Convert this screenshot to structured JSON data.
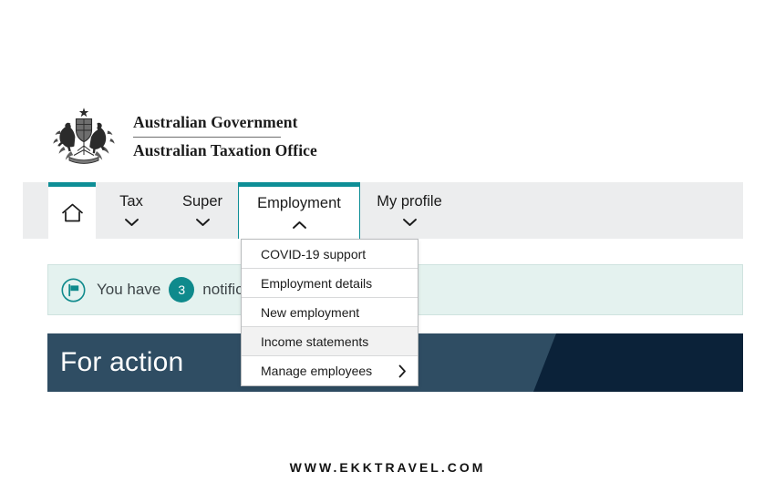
{
  "masthead": {
    "emblem_icon": "australian-coat-of-arms",
    "line1": "Australian Government",
    "line2": "Australian Taxation Office"
  },
  "nav": {
    "home": {
      "label": "Home",
      "icon": "home-icon"
    },
    "items": [
      {
        "label": "Tax",
        "icon": "chevron-down-icon",
        "active": false
      },
      {
        "label": "Super",
        "icon": "chevron-down-icon",
        "active": false
      },
      {
        "label": "Employment",
        "icon": "chevron-up-icon",
        "active": true
      },
      {
        "label": "My profile",
        "icon": "chevron-down-icon",
        "active": false
      }
    ],
    "accent_color": "#0e8e96",
    "background_color": "#ecedee"
  },
  "dropdown": {
    "parent": "Employment",
    "items": [
      {
        "label": "COVID-19 support",
        "highlighted": false,
        "has_submenu": false
      },
      {
        "label": "Employment details",
        "highlighted": false,
        "has_submenu": false
      },
      {
        "label": "New employment",
        "highlighted": false,
        "has_submenu": false
      },
      {
        "label": "Income statements",
        "highlighted": true,
        "has_submenu": false
      },
      {
        "label": "Manage employees",
        "highlighted": false,
        "has_submenu": true,
        "submenu_icon": "chevron-right-icon"
      }
    ]
  },
  "notification": {
    "icon": "flag-circle-icon",
    "text_before": "You have",
    "count": "3",
    "text_after": "notifications",
    "badge_color": "#0f8a8c",
    "background_color": "#e4f2ef"
  },
  "banner": {
    "title": "For action",
    "left_color": "#2f4d63",
    "right_color": "#0b2239"
  },
  "footer": {
    "watermark": "WWW.EKKTRAVEL.COM"
  }
}
